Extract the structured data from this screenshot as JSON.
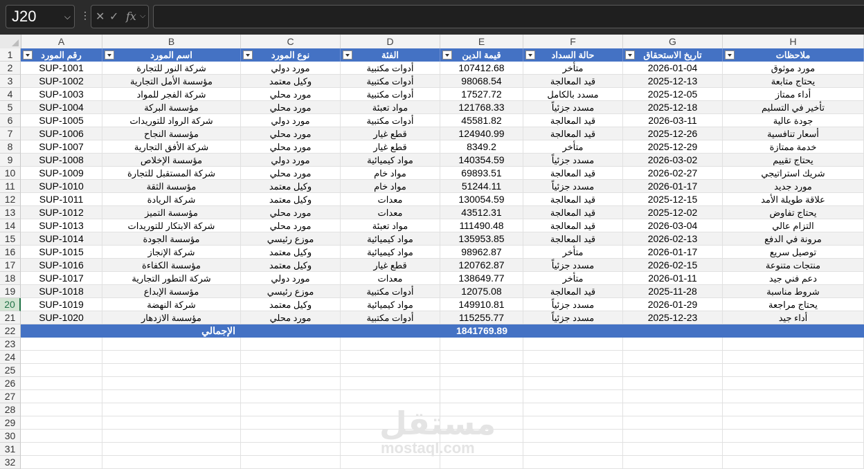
{
  "toolbar": {
    "namebox": "J20",
    "cancel_icon": "close-icon",
    "enter_icon": "check-icon",
    "fx_label": "fx",
    "formula": ""
  },
  "columns": [
    "A",
    "B",
    "C",
    "D",
    "E",
    "F",
    "G",
    "H"
  ],
  "headers": [
    "رقم المورد",
    "اسم المورد",
    "نوع المورد",
    "الفئة",
    "قيمة الدين",
    "حالة السداد",
    "تاريخ الاستحقاق",
    "ملاحظات"
  ],
  "rows": [
    [
      "SUP-1001",
      "شركة النور للتجارة",
      "مورد دولي",
      "أدوات مكتبية",
      "107412.68",
      "متأخر",
      "2026-01-04",
      "مورد موثوق"
    ],
    [
      "SUP-1002",
      "مؤسسة الأمل التجارية",
      "وكيل معتمد",
      "أدوات مكتبية",
      "98068.54",
      "قيد المعالجة",
      "2025-12-13",
      "يحتاج متابعة"
    ],
    [
      "SUP-1003",
      "شركة الفجر للمواد",
      "مورد محلي",
      "أدوات مكتبية",
      "17527.72",
      "مسدد بالكامل",
      "2025-12-05",
      "أداء ممتاز"
    ],
    [
      "SUP-1004",
      "مؤسسة البركة",
      "مورد محلي",
      "مواد تعبئة",
      "121768.33",
      "مسدد جزئياً",
      "2025-12-18",
      "تأخير في التسليم"
    ],
    [
      "SUP-1005",
      "شركة الرواد للتوريدات",
      "مورد دولي",
      "أدوات مكتبية",
      "45581.82",
      "قيد المعالجة",
      "2026-03-11",
      "جودة عالية"
    ],
    [
      "SUP-1006",
      "مؤسسة النجاح",
      "مورد محلي",
      "قطع غيار",
      "124940.99",
      "قيد المعالجة",
      "2025-12-26",
      "أسعار تنافسية"
    ],
    [
      "SUP-1007",
      "شركة الأفق التجارية",
      "مورد محلي",
      "قطع غيار",
      "8349.2",
      "متأخر",
      "2025-12-29",
      "خدمة ممتازة"
    ],
    [
      "SUP-1008",
      "مؤسسة الإخلاص",
      "مورد دولي",
      "مواد كيميائية",
      "140354.59",
      "مسدد جزئياً",
      "2026-03-02",
      "يحتاج تقييم"
    ],
    [
      "SUP-1009",
      "شركة المستقبل للتجارة",
      "مورد محلي",
      "مواد خام",
      "69893.51",
      "قيد المعالجة",
      "2026-02-27",
      "شريك استراتيجي"
    ],
    [
      "SUP-1010",
      "مؤسسة الثقة",
      "وكيل معتمد",
      "مواد خام",
      "51244.11",
      "مسدد جزئياً",
      "2026-01-17",
      "مورد جديد"
    ],
    [
      "SUP-1011",
      "شركة الريادة",
      "وكيل معتمد",
      "معدات",
      "130054.59",
      "قيد المعالجة",
      "2025-12-15",
      "علاقة طويلة الأمد"
    ],
    [
      "SUP-1012",
      "مؤسسة التميز",
      "مورد محلي",
      "معدات",
      "43512.31",
      "قيد المعالجة",
      "2025-12-02",
      "يحتاج تفاوض"
    ],
    [
      "SUP-1013",
      "شركة الابتكار للتوريدات",
      "مورد محلي",
      "مواد تعبئة",
      "111490.48",
      "قيد المعالجة",
      "2026-03-04",
      "التزام عالي"
    ],
    [
      "SUP-1014",
      "مؤسسة الجودة",
      "موزع رئيسي",
      "مواد كيميائية",
      "135953.85",
      "قيد المعالجة",
      "2026-02-13",
      "مرونة في الدفع"
    ],
    [
      "SUP-1015",
      "شركة الإنجاز",
      "وكيل معتمد",
      "مواد كيميائية",
      "98962.87",
      "متأخر",
      "2026-01-17",
      "توصيل سريع"
    ],
    [
      "SUP-1016",
      "مؤسسة الكفاءة",
      "وكيل معتمد",
      "قطع غيار",
      "120762.87",
      "مسدد جزئياً",
      "2026-02-15",
      "منتجات متنوعة"
    ],
    [
      "SUP-1017",
      "شركة التطور التجارية",
      "مورد دولي",
      "معدات",
      "138649.77",
      "متأخر",
      "2026-01-11",
      "دعم فني جيد"
    ],
    [
      "SUP-1018",
      "مؤسسة الإبداع",
      "موزع رئيسي",
      "أدوات مكتبية",
      "12075.08",
      "قيد المعالجة",
      "2025-11-28",
      "شروط مناسبة"
    ],
    [
      "SUP-1019",
      "شركة النهضة",
      "وكيل معتمد",
      "مواد كيميائية",
      "149910.81",
      "مسدد جزئياً",
      "2026-01-29",
      "يحتاج مراجعة"
    ],
    [
      "SUP-1020",
      "مؤسسة الازدهار",
      "مورد محلي",
      "أدوات مكتبية",
      "115255.77",
      "مسدد جزئياً",
      "2025-12-23",
      "أداء جيد"
    ]
  ],
  "total": {
    "label": "الإجمالي",
    "value": "1841769.89"
  },
  "row_numbers": [
    "1",
    "2",
    "3",
    "4",
    "5",
    "6",
    "7",
    "8",
    "9",
    "10",
    "11",
    "12",
    "13",
    "14",
    "15",
    "16",
    "17",
    "18",
    "19",
    "20",
    "21",
    "22",
    "23",
    "24",
    "25",
    "26",
    "27",
    "28",
    "29",
    "30",
    "31",
    "32"
  ],
  "watermark": {
    "logo_text": "مستقل",
    "url_text": "mostaql.com"
  }
}
